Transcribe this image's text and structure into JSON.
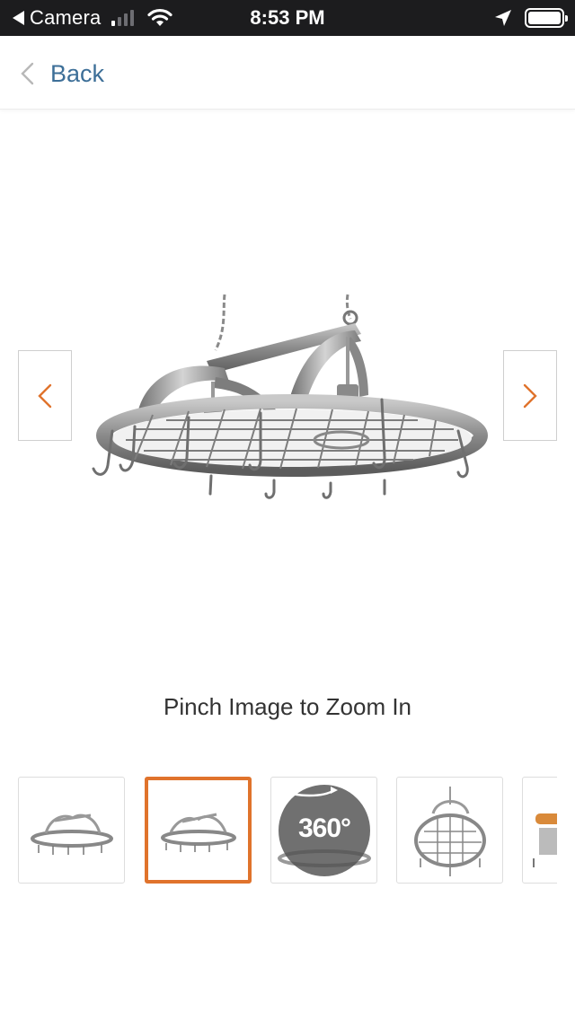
{
  "status_bar": {
    "back_app": "Camera",
    "time": "8:53 PM",
    "signal_bars": 4,
    "signal_bars_active": 1
  },
  "header": {
    "back_label": "Back",
    "accent_color": "#3d6f98"
  },
  "gallery": {
    "zoom_hint": "Pinch Image to Zoom In",
    "arrow_color": "#e0732c",
    "selected_index": 1,
    "thumbnails": [
      {
        "kind": "image",
        "subject": "pot rack front view"
      },
      {
        "kind": "image",
        "subject": "pot rack angled view"
      },
      {
        "kind": "360",
        "badge": "360°"
      },
      {
        "kind": "image",
        "subject": "pot rack top view"
      },
      {
        "kind": "image",
        "subject": "pot rack with pans"
      }
    ]
  }
}
